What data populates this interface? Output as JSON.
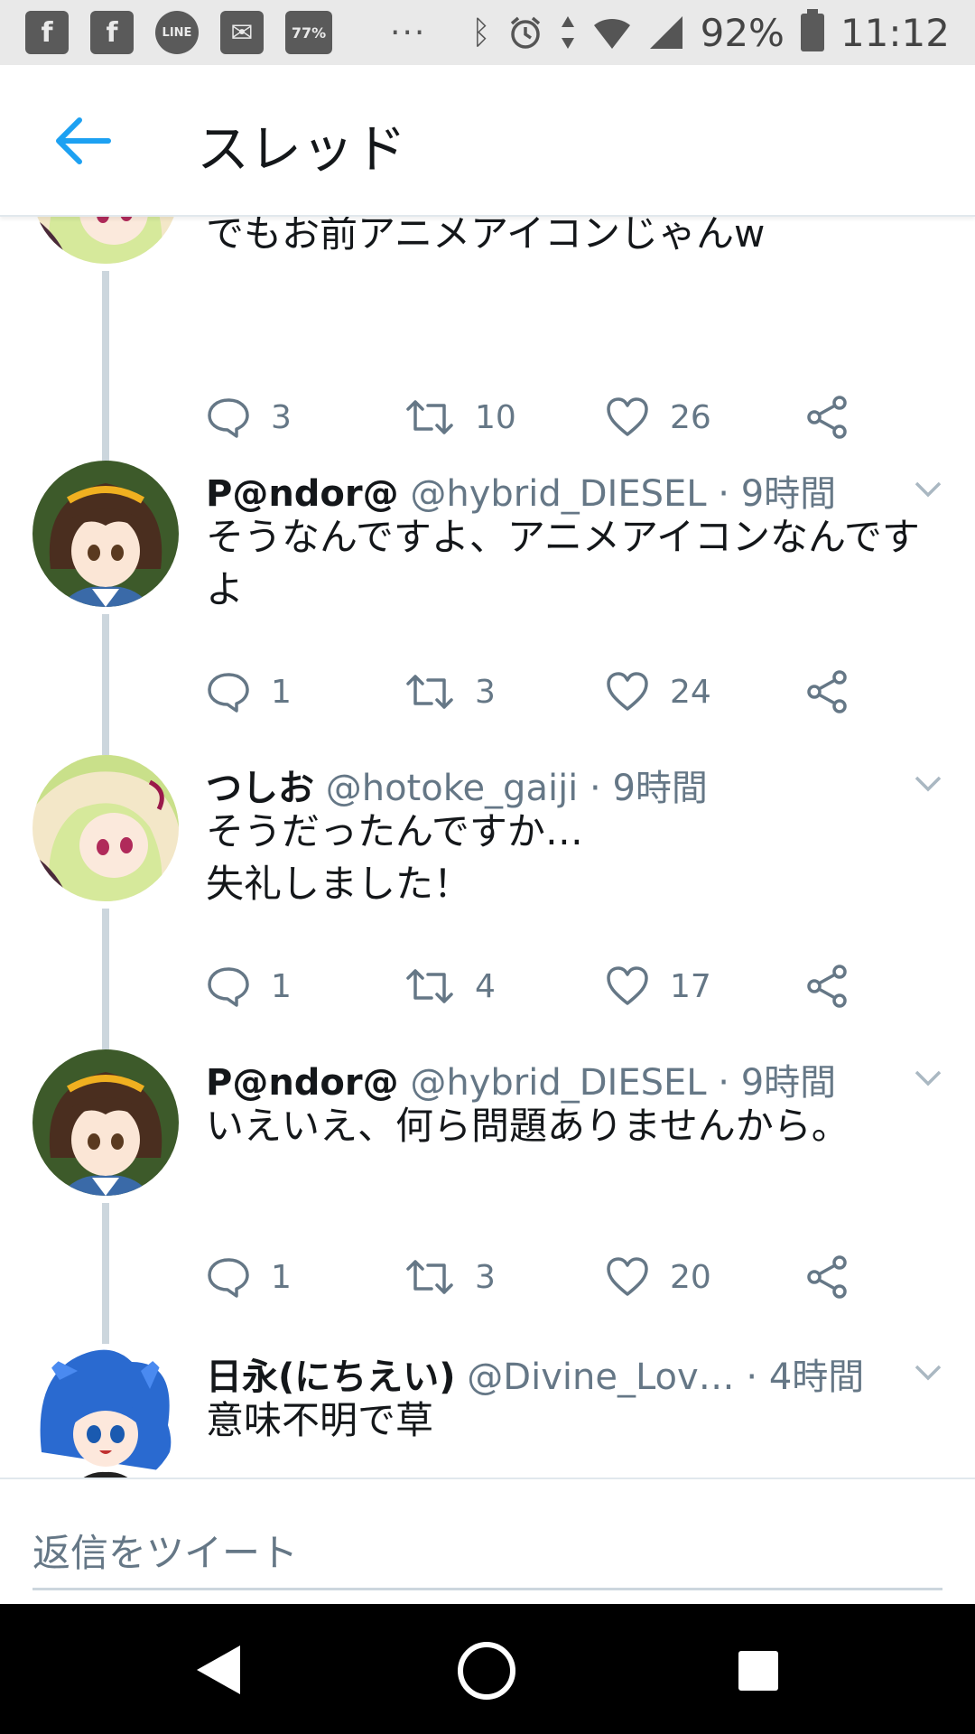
{
  "status_bar": {
    "icons": [
      "facebook-icon",
      "facebook-icon",
      "line-icon",
      "mail-icon",
      "notification-77-icon",
      "bluetooth-icon",
      "alarm-icon",
      "data-icon",
      "wifi-icon",
      "signal-icon",
      "battery-icon"
    ],
    "badge_line": "LINE",
    "badge_percent": "77%",
    "overflow": "···",
    "battery": "92%",
    "time": "11:12"
  },
  "app_bar": {
    "title": "スレッド"
  },
  "tweets": [
    {
      "name": "",
      "handle": "",
      "time": "",
      "text": "でもお前アニメアイコンじゃんw",
      "replies": "3",
      "retweets": "10",
      "likes": "26",
      "avatar": "green-hair-anime-avatar"
    },
    {
      "name": "P@ndor@",
      "handle": "@hybrid_DIESEL",
      "time": "· 9時間",
      "text": "そうなんですよ、アニメアイコンなんですよ",
      "replies": "1",
      "retweets": "3",
      "likes": "24",
      "avatar": "brown-hair-anime-avatar"
    },
    {
      "name": "つしお",
      "handle": "@hotoke_gaiji",
      "time": "· 9時間",
      "text": "そうだったんですか…\n失礼しました！",
      "replies": "1",
      "retweets": "4",
      "likes": "17",
      "avatar": "green-hair-anime-avatar"
    },
    {
      "name": "P@ndor@",
      "handle": "@hybrid_DIESEL",
      "time": "· 9時間",
      "text": "いえいえ、何ら問題ありませんから。",
      "replies": "1",
      "retweets": "3",
      "likes": "20",
      "avatar": "brown-hair-anime-avatar"
    },
    {
      "name": "日永(にちえい)",
      "handle": "@Divine_Lov…",
      "time": "· 4時間",
      "text": "意味不明で草",
      "avatar": "blue-hair-anime-avatar"
    }
  ],
  "reply_bar": {
    "placeholder": "返信をツイート"
  },
  "colors": {
    "accent": "#1da1f2",
    "secondary_text": "#657786",
    "thread_line": "#ccd6dd"
  }
}
